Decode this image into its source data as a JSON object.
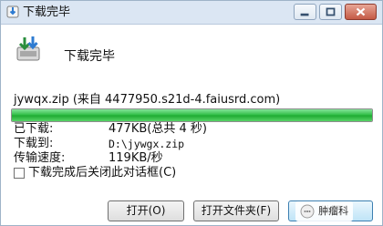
{
  "window": {
    "title": "下载完毕"
  },
  "header": {
    "heading": "下载完毕"
  },
  "download": {
    "source": "jywqx.zip (来自 4477950.s21d-4.faiusrd.com)",
    "progress_fraction": 1.0,
    "fields": [
      {
        "label": "已下载:",
        "value": "477KB(总共 4 秒)"
      },
      {
        "label": "下载到:",
        "value": "D:\\jywgx.zip"
      },
      {
        "label": "传输速度:",
        "value": "119KB/秒"
      }
    ]
  },
  "options": {
    "close_on_complete_label": "下载完成后关闭此对话框(C)",
    "close_on_complete_checked": false
  },
  "buttons": {
    "open": "打开(O)",
    "open_folder": "打开文件夹(F)",
    "close": "关闭"
  },
  "watermark": {
    "text": "肿瘤科"
  },
  "colors": {
    "progress": "#2fbd45",
    "titlebar": "#dbe6f3",
    "close_caption": "#c45a45"
  },
  "icons": {
    "title": "download-icon",
    "file": "download-icon",
    "minimize": "minimize-icon",
    "maximize": "maximize-icon",
    "close": "close-icon"
  }
}
